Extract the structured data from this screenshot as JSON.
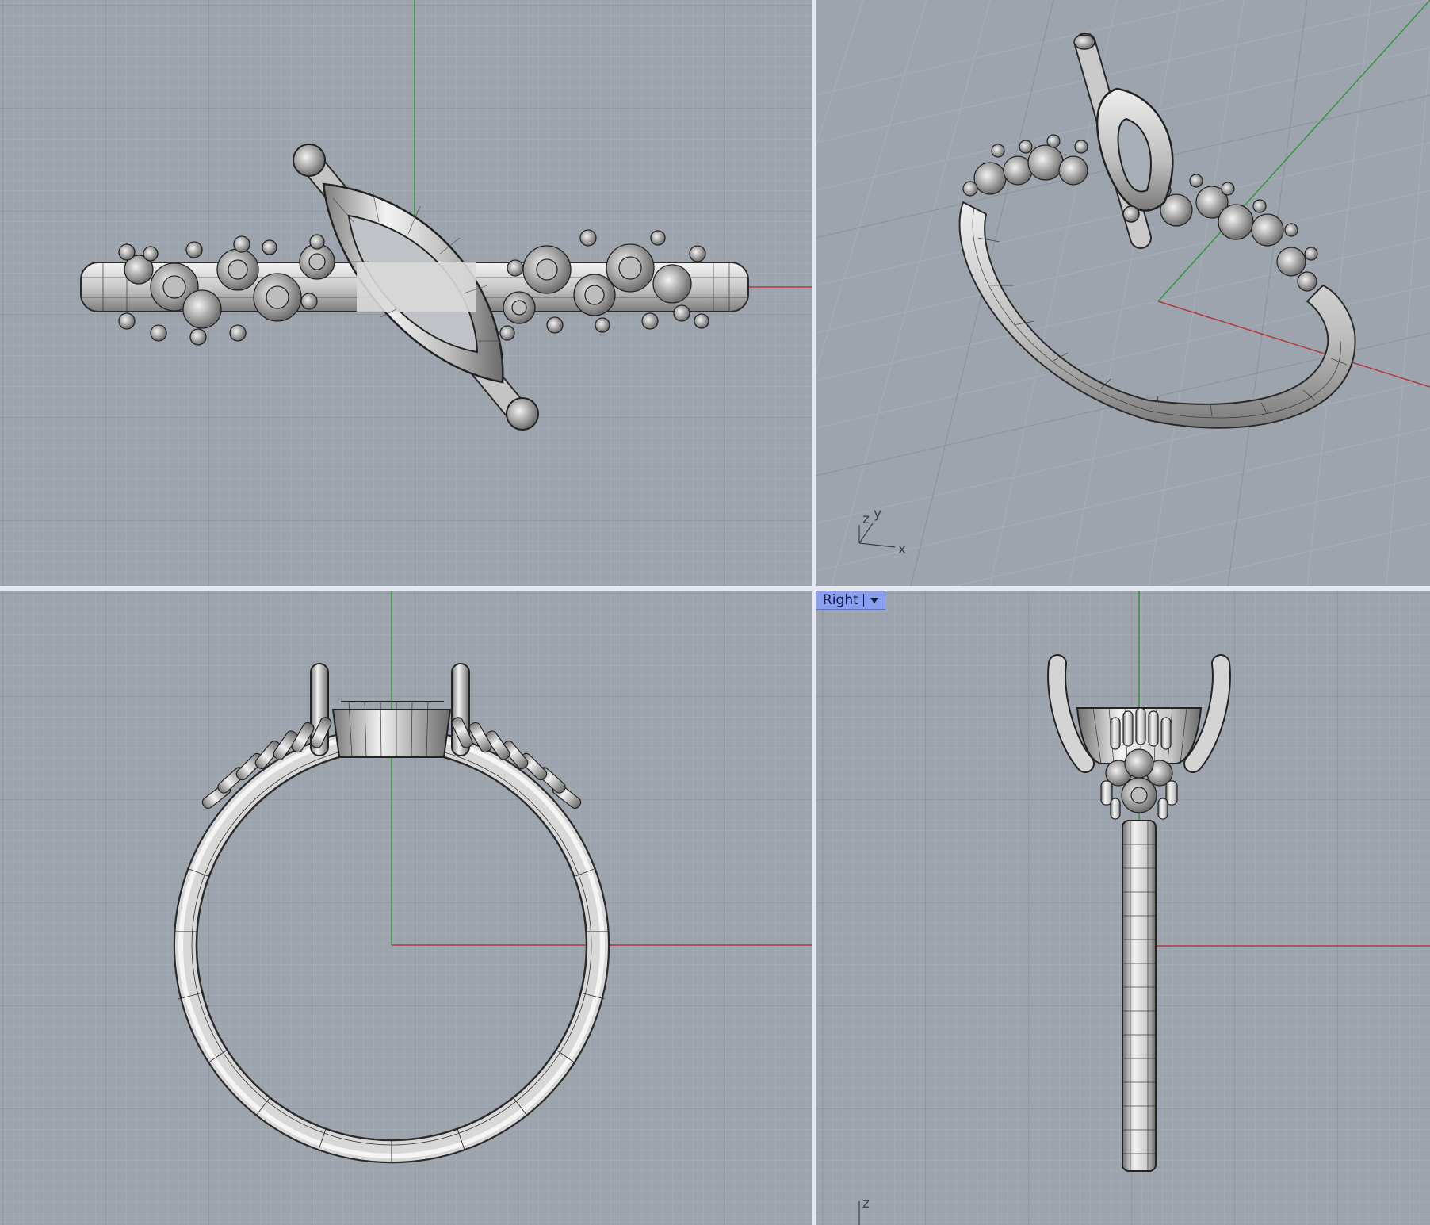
{
  "viewports": {
    "top": {
      "label": ""
    },
    "perspective": {
      "label": "",
      "axis_labels": {
        "x": "x",
        "y": "y",
        "z": "z"
      }
    },
    "front": {
      "label": ""
    },
    "right": {
      "label": "Right",
      "axis_labels": {
        "z": "z"
      }
    }
  },
  "colors": {
    "background": "#9ea4ad",
    "grid_minor": "#a7adb6",
    "grid_major": "#878d97",
    "axis_x": "#b03a3a",
    "axis_y": "#2e9a3c",
    "model_fill": "#d8d8d8",
    "wireframe": "#2a2a2a",
    "active_tab": "#8aa0ee"
  },
  "icons": {
    "viewport_menu": "chevron-down-icon"
  }
}
